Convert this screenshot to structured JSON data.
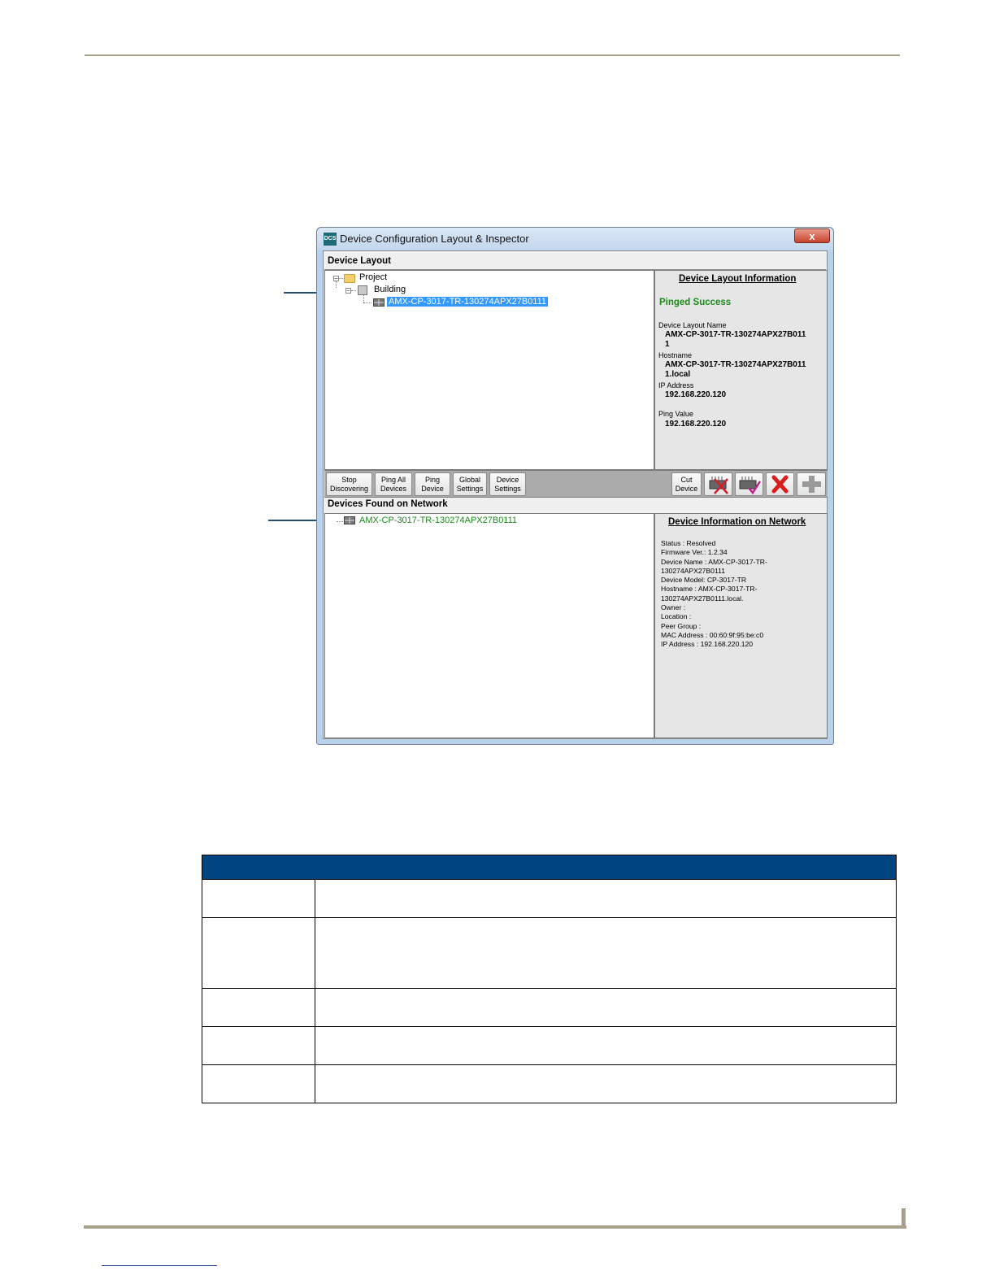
{
  "window": {
    "title": "Device Configuration Layout & Inspector",
    "icon_text": "DCS",
    "close_label": "x"
  },
  "device_layout": {
    "section_label": "Device Layout",
    "tree": {
      "project": "Project",
      "building": "Building",
      "device": "AMX-CP-3017-TR-130274APX27B0111"
    },
    "info": {
      "title": "Device Layout Information",
      "status": "Pinged Success",
      "layout_name_label": "Device Layout Name",
      "layout_name_line1": "AMX-CP-3017-TR-130274APX27B011",
      "layout_name_line2": "1",
      "hostname_label": "Hostname",
      "hostname_line1": "AMX-CP-3017-TR-130274APX27B011",
      "hostname_line2": "1.local",
      "ip_label": "IP Address",
      "ip_value": "192.168.220.120",
      "ping_label": "Ping Value",
      "ping_value": "192.168.220.120"
    }
  },
  "toolbar": {
    "stop_line1": "Stop",
    "stop_line2": "Discovering",
    "pingall_line1": "Ping All",
    "pingall_line2": "Devices",
    "ping_line1": "Ping",
    "ping_line2": "Device",
    "global_line1": "Global",
    "global_line2": "Settings",
    "device_line1": "Device",
    "device_line2": "Settings",
    "cut_line1": "Cut",
    "cut_line2": "Device",
    "icons": [
      "remove-device-icon",
      "check-device-icon",
      "delete-icon",
      "add-icon"
    ]
  },
  "network": {
    "section_label": "Devices Found on Network",
    "device": "AMX-CP-3017-TR-130274APX27B0111",
    "device_color": "#1a8a1a",
    "info": {
      "title": "Device Information on Network",
      "lines": [
        "Status     : Resolved",
        "Firmware Ver.: 1.2.34",
        "Device Name : AMX-CP-3017-TR-",
        "130274APX27B0111",
        "Device Model: CP-3017-TR",
        "Hostname   : AMX-CP-3017-TR-",
        "130274APX27B0111.local.",
        "Owner      :",
        "Location    :",
        "Peer Group  :",
        "MAC Address : 00:60:9f:95:be:c0",
        "IP Address  : 192.168.220.120"
      ]
    }
  },
  "colors": {
    "accent": "#004481",
    "success": "#1a8a1a",
    "selection": "#3399ff",
    "rule": "#a6a08c"
  }
}
